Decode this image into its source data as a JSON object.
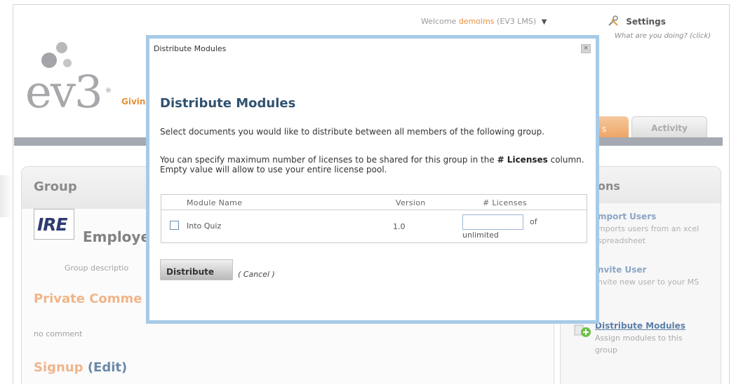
{
  "header": {
    "welcome_prefix": "Welcome",
    "welcome_user": "demolms",
    "welcome_suffix": "(EV3 LMS)",
    "settings_label": "Settings",
    "what_doing": "What are you doing? (click)",
    "logo_text": "ev3",
    "logo_reg": "®",
    "tagline_fragment": "Giving"
  },
  "tabs": {
    "partial_tab_label": "s",
    "activity_label": "Activity"
  },
  "group_panel": {
    "title": "Group",
    "logo_text": "IRE",
    "name_fragment": "Employee",
    "description_fragment": "Group descriptio",
    "private_comments_fragment": "Private Comme",
    "no_comment": "no comment",
    "signup_label": "Signup",
    "signup_edit": "(Edit)"
  },
  "operations_panel": {
    "title_fragment": "ons",
    "import_title": "mport Users",
    "import_desc": "mports users from an xcel spreadsheet",
    "invite_title": "nvite User",
    "invite_desc": "nvite new user to your MS",
    "distribute_title": "Distribute Modules",
    "distribute_desc": "Assign modules to this group"
  },
  "modal": {
    "window_title": "Distribute Modules",
    "close_glyph": "×",
    "heading": "Distribute Modules",
    "intro": "Select documents you would like to distribute between all members of the following group.",
    "hint_pre": "You can specify maximum number of licenses to be shared for this group in the ",
    "hint_bold": "# Licenses",
    "hint_post": " column. Empty value will allow to use your entire license pool.",
    "table": {
      "columns": [
        "Module Name",
        "Version",
        "# Licenses"
      ],
      "rows": [
        {
          "name": "Into Quiz",
          "version": "1.0",
          "licenses_value": "",
          "of_label": "of",
          "limit_label": "unlimited"
        }
      ]
    },
    "distribute_button": "Distribute",
    "cancel_label": "( Cancel )"
  },
  "colors": {
    "accent_orange": "#e6903a",
    "modal_border": "#a6cbe8",
    "heading_blue": "#305270",
    "link_blue": "#5b7fa8"
  }
}
